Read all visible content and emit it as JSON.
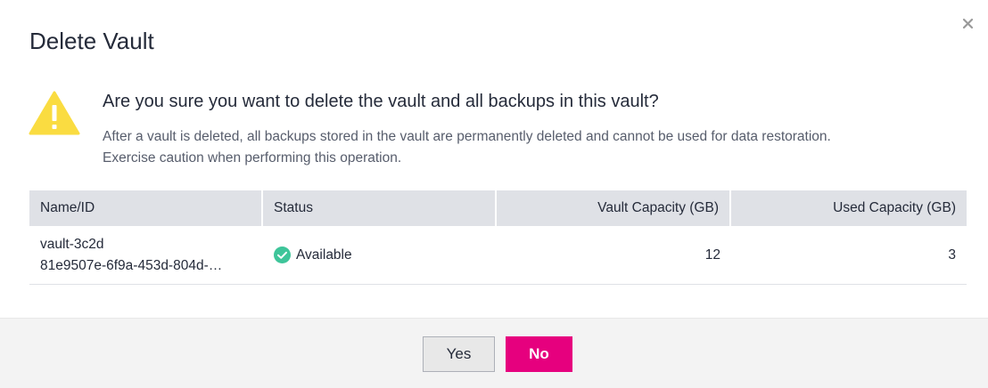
{
  "dialog": {
    "title": "Delete Vault",
    "question": "Are you sure you want to delete the vault and all backups in this vault?",
    "description_line1": "After a vault is deleted, all backups stored in the vault are permanently deleted and cannot be used for data restoration.",
    "description_line2": "Exercise caution when performing this operation.",
    "close_icon": "close-icon",
    "warning_icon": "warning-triangle-icon"
  },
  "table": {
    "headers": {
      "name_id": "Name/ID",
      "status": "Status",
      "vault_capacity": "Vault Capacity (GB)",
      "used_capacity": "Used Capacity (GB)"
    },
    "rows": [
      {
        "name": "vault-3c2d",
        "id": "81e9507e-6f9a-453d-804d-…",
        "status": "Available",
        "status_icon": "check-circle-icon",
        "vault_capacity": "12",
        "used_capacity": "3"
      }
    ]
  },
  "footer": {
    "yes_label": "Yes",
    "no_label": "No"
  },
  "colors": {
    "primary_button": "#e6007e",
    "warning": "#fadc41",
    "status_available": "#3ec59a",
    "header_bg": "#dfe1e6",
    "footer_bg": "#f3f3f3"
  }
}
